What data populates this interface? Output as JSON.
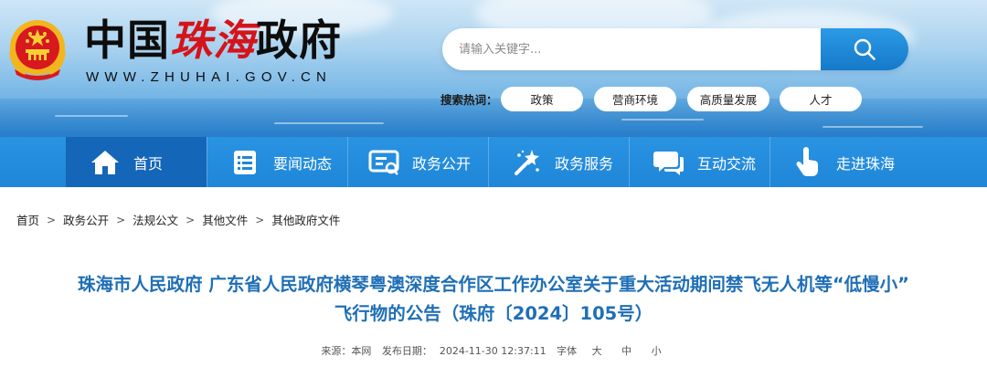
{
  "header": {
    "site_name_prefix": "中国",
    "site_name_city": "珠海",
    "site_name_suffix": "政府",
    "site_url": "WWW.ZHUHAI.GOV.CN"
  },
  "search": {
    "placeholder": "请输入关键字...",
    "button_icon": "search-icon"
  },
  "hot_search": {
    "label": "搜索热词：",
    "tags": [
      "政策",
      "营商环境",
      "高质量发展",
      "人才"
    ]
  },
  "nav": {
    "items": [
      {
        "label": "首页",
        "icon": "home-icon",
        "active": true
      },
      {
        "label": "要闻动态",
        "icon": "news-list-icon",
        "active": false
      },
      {
        "label": "政务公开",
        "icon": "gov-open-icon",
        "active": false
      },
      {
        "label": "政务服务",
        "icon": "magic-wand-icon",
        "active": false
      },
      {
        "label": "互动交流",
        "icon": "chat-icon",
        "active": false
      },
      {
        "label": "走进珠海",
        "icon": "hand-pointer-icon",
        "active": false
      }
    ]
  },
  "breadcrumb": [
    "首页",
    "政务公开",
    "法规公文",
    "其他文件",
    "其他政府文件"
  ],
  "breadcrumb_sep": ">",
  "article": {
    "title_line1": "珠海市人民政府 广东省人民政府横琴粤澳深度合作区工作办公室关于重大活动期间禁飞无人机等“低慢小”",
    "title_line2": "飞行物的公告（珠府〔2024〕105号）",
    "source_label": "来源：本网",
    "publish_label": "发布日期：",
    "publish_time": "2024-11-30 12:37:11",
    "font_label": "字体",
    "font_large": "大",
    "font_medium": "中",
    "font_small": "小"
  },
  "colors": {
    "nav_bg": "#1f86d8",
    "nav_active": "#1466b8",
    "title_blue": "#1f6fb6",
    "brand_red": "#d4141b"
  }
}
